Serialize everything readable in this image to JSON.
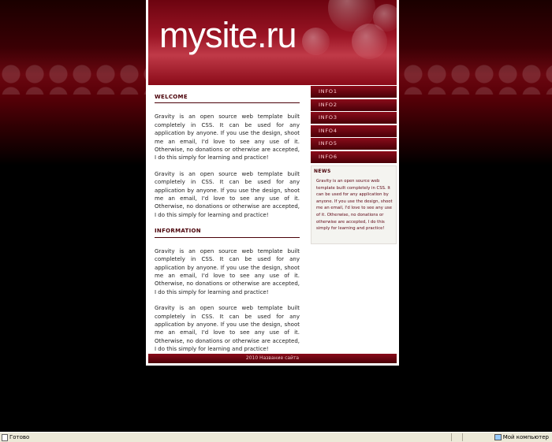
{
  "header": {
    "logo": "mysite.ru"
  },
  "main": {
    "sections": [
      {
        "title": "WELCOME",
        "paragraphs": [
          "Gravity is an open source web template built completely in CSS. It can be used for any application by anyone. If you use the design, shoot me an email, I'd love to see any use of it. Otherwise, no donations or otherwise are accepted, I do this simply for learning and practice!",
          "Gravity is an open source web template built completely in CSS. It can be used for any application by anyone. If you use the design, shoot me an email, I'd love to see any use of it. Otherwise, no donations or otherwise are accepted, I do this simply for learning and practice!"
        ]
      },
      {
        "title": "INFORMATION",
        "paragraphs": [
          "Gravity is an open source web template built completely in CSS. It can be used for any application by anyone. If you use the design, shoot me an email, I'd love to see any use of it. Otherwise, no donations or otherwise are accepted, I do this simply for learning and practice!",
          "Gravity is an open source web template built completely in CSS. It can be used for any application by anyone. If you use the design, shoot me an email, I'd love to see any use of it. Otherwise, no donations or otherwise are accepted, I do this simply for learning and practice!"
        ]
      }
    ]
  },
  "sidebar": {
    "menu": [
      "INFO1",
      "INFO2",
      "INFO3",
      "INFO4",
      "INFO5",
      "INFO6"
    ],
    "news": {
      "title": "NEWS",
      "text": "Gravity is an open source web template built completely in CSS. It can be used for any application by anyone. If you use the design, shoot me an email, I'd love to see any use of it. Otherwise, no donations or otherwise are accepted, I do this simply for learning and practice!"
    }
  },
  "footer": {
    "text": "2010 Название сайта"
  },
  "statusbar": {
    "left": "Готово",
    "right": "Мой компьютер"
  },
  "colors": {
    "accent": "#7a0612",
    "background": "#000000",
    "panel": "#ffffff"
  }
}
